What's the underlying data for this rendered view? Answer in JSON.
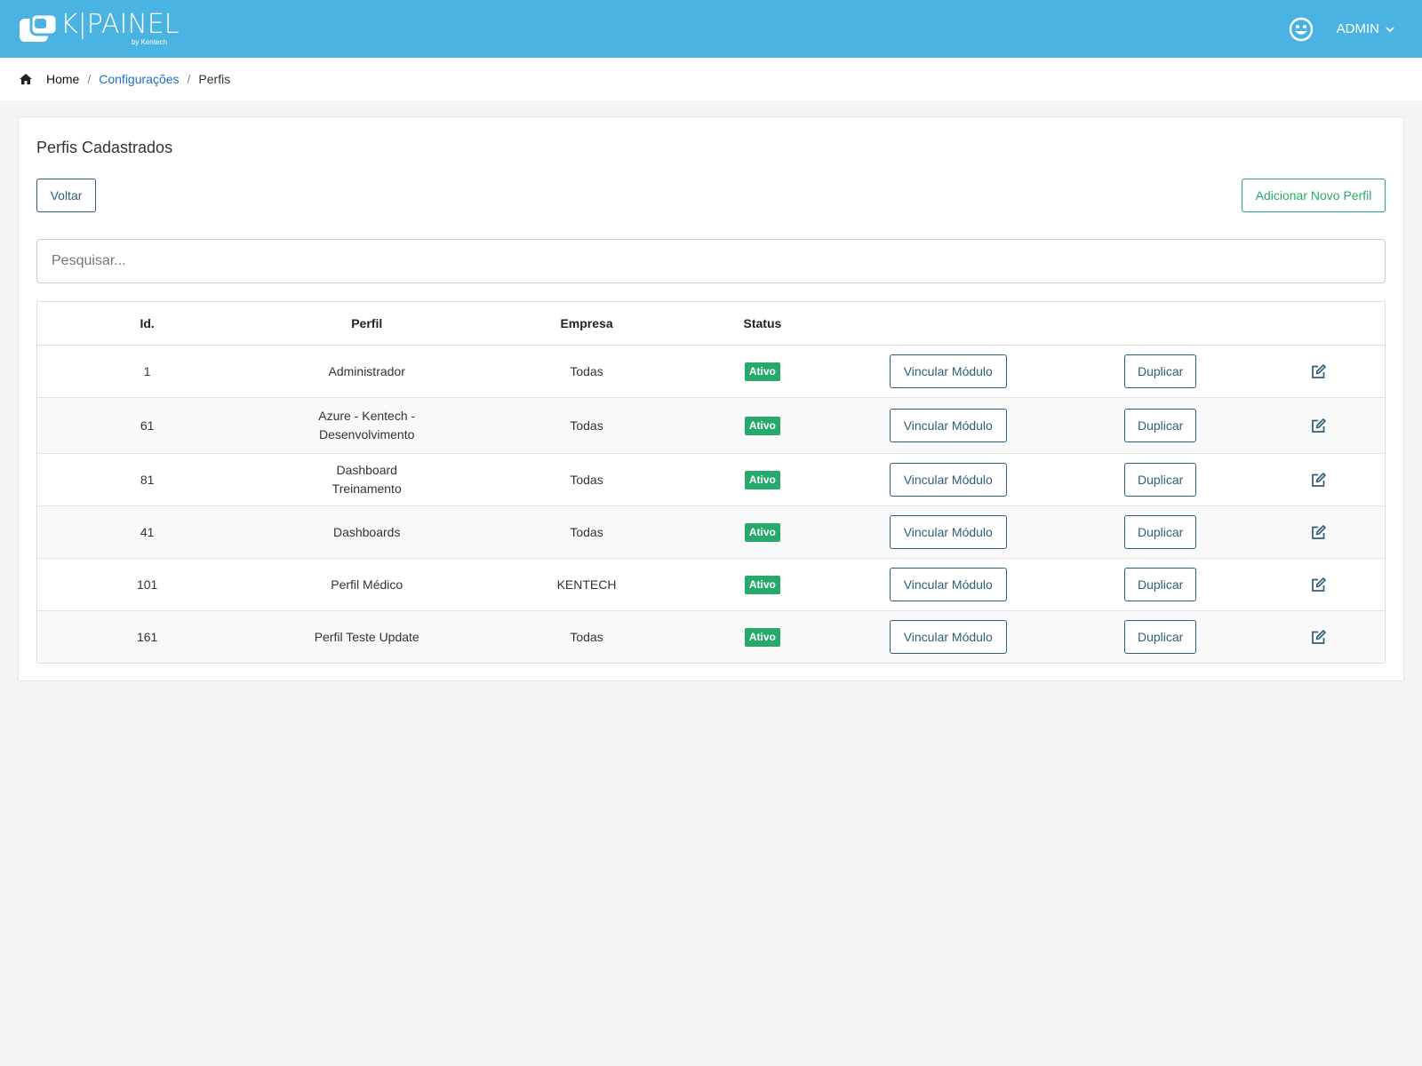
{
  "colors": {
    "topbar": "#4bb3e2",
    "primary_outline": "#2e5f78",
    "success": "#27a96b",
    "link": "#1a6fc9"
  },
  "header": {
    "logo_text": "K|PAINEL",
    "logo_sub": "by Kentech",
    "user_icon": "smiley-face-icon",
    "user_name": "ADMIN"
  },
  "breadcrumb": {
    "home_icon": "home-icon",
    "items": [
      "Home",
      "Configurações",
      "Perfis"
    ],
    "separator": "/"
  },
  "page": {
    "title": "Perfis Cadastrados",
    "back_label": "Voltar",
    "add_label": "Adicionar Novo Perfil",
    "search_placeholder": "Pesquisar...",
    "search_value": ""
  },
  "table": {
    "columns": [
      "Id.",
      "Perfil",
      "Empresa",
      "Status",
      "",
      "",
      ""
    ],
    "action_labels": {
      "link": "Vincular Módulo",
      "duplicate": "Duplicar",
      "edit_icon": "edit-icon"
    },
    "rows": [
      {
        "id": "1",
        "perfil": "Administrador",
        "empresa": "Todas",
        "status": "Ativo"
      },
      {
        "id": "61",
        "perfil": "Azure - Kentech - Desenvolvimento",
        "empresa": "Todas",
        "status": "Ativo"
      },
      {
        "id": "81",
        "perfil": "Dashboard Treinamento",
        "empresa": "Todas",
        "status": "Ativo"
      },
      {
        "id": "41",
        "perfil": "Dashboards",
        "empresa": "Todas",
        "status": "Ativo"
      },
      {
        "id": "101",
        "perfil": "Perfil Médico",
        "empresa": "KENTECH",
        "status": "Ativo"
      },
      {
        "id": "161",
        "perfil": "Perfil Teste Update",
        "empresa": "Todas",
        "status": "Ativo"
      }
    ]
  }
}
